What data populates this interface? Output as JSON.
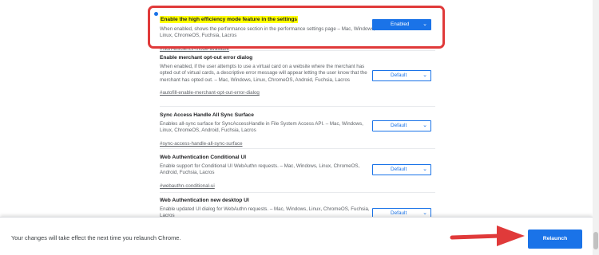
{
  "flags": [
    {
      "title": "Enable the high efficiency mode feature in the settings",
      "description": "When enabled, shows the performance section in the performance settings page – Mac, Windows, Linux, ChromeOS, Fuchsia, Lacros",
      "link": "#high-efficiency-mode-available",
      "select_value": "Enabled",
      "modified": true
    },
    {
      "title": "Enable merchant opt-out error dialog",
      "description": "When enabled, if the user attempts to use a virtual card on a website where the merchant has opted out of virtual cards, a descriptive error message will appear letting the user know that the merchant has opted out. – Mac, Windows, Linux, ChromeOS, Android, Fuchsia, Lacros",
      "link": "#autofill-enable-merchant-opt-out-error-dialog",
      "select_value": "Default",
      "modified": false
    },
    {
      "title": "Sync Access Handle All Sync Surface",
      "description": "Enables all-sync surface for SyncAccessHandle in File System Access API. – Mac, Windows, Linux, ChromeOS, Android, Fuchsia, Lacros",
      "link": "#sync-access-handle-all-sync-surface",
      "select_value": "Default",
      "modified": false
    },
    {
      "title": "Web Authentication Conditional UI",
      "description": "Enable support for Conditional UI WebAuthn requests. – Mac, Windows, Linux, ChromeOS, Android, Fuchsia, Lacros",
      "link": "#webauthn-conditional-ui",
      "select_value": "Default",
      "modified": false
    },
    {
      "title": "Web Authentication new desktop UI",
      "description": "Enable updated UI dialog for WebAuthn requests. – Mac, Windows, Linux, ChromeOS, Fuchsia, Lacros",
      "link": "",
      "select_value": "Default",
      "modified": false
    }
  ],
  "footer": {
    "message": "Your changes will take effect the next time you relaunch Chrome.",
    "relaunch_label": "Relaunch"
  },
  "icons": {
    "select_chevron": "chevron-down-icon",
    "annotation_arrow": "red-arrow-icon",
    "modified_indicator": "blue-dot-icon"
  },
  "colors": {
    "accent": "#1a73e8",
    "highlight": "#ffff00",
    "annotation": "#e03a3a"
  }
}
